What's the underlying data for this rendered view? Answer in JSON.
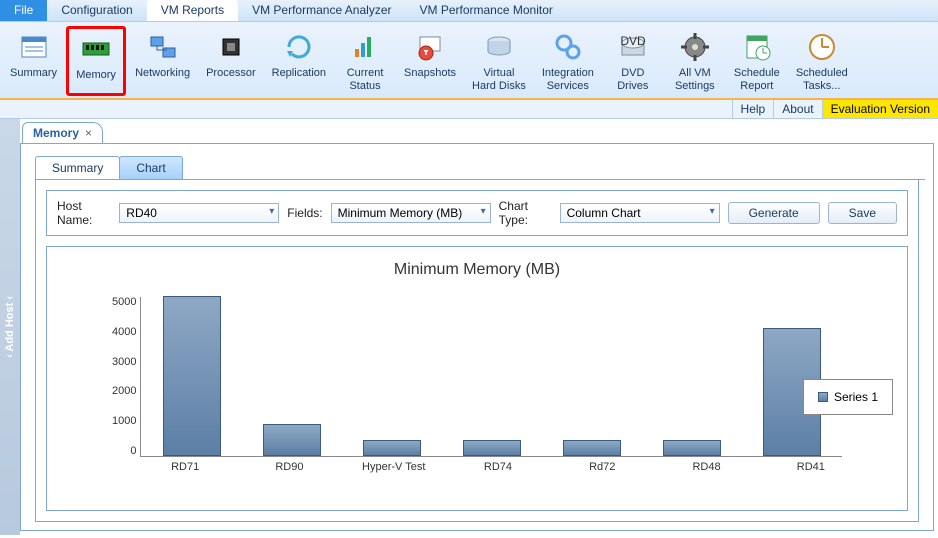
{
  "menu": {
    "file": "File",
    "config": "Configuration",
    "vmreports": "VM Reports",
    "analyzer": "VM Performance Analyzer",
    "monitor": "VM Performance Monitor"
  },
  "ribbon": {
    "summary": "Summary",
    "memory": "Memory",
    "networking": "Networking",
    "processor": "Processor",
    "replication": "Replication",
    "current_status": "Current\nStatus",
    "snapshots": "Snapshots",
    "virtual_hard_disks": "Virtual\nHard Disks",
    "integration_services": "Integration\nServices",
    "dvd_drives": "DVD\nDrives",
    "all_vm_settings": "All VM\nSettings",
    "schedule_report": "Schedule\nReport",
    "scheduled_tasks": "Scheduled\nTasks..."
  },
  "helpline": {
    "help": "Help",
    "about": "About",
    "eval": "Evaluation Version"
  },
  "side": {
    "add_host": "‹   Add Host   ‹"
  },
  "doc_tab": {
    "label": "Memory",
    "close": "×"
  },
  "inner_tabs": {
    "summary": "Summary",
    "chart": "Chart"
  },
  "controls": {
    "host_label": "Host Name:",
    "host_value": "RD40",
    "fields_label": "Fields:",
    "fields_value": "Minimum Memory (MB)",
    "charttype_label": "Chart Type:",
    "charttype_value": "Column Chart",
    "generate": "Generate",
    "save": "Save"
  },
  "chart_data": {
    "type": "bar",
    "title": "Minimum Memory (MB)",
    "categories": [
      "RD71",
      "RD90",
      "Hyper-V Test",
      "RD74",
      "Rd72",
      "RD48",
      "RD41"
    ],
    "values": [
      5000,
      1000,
      500,
      500,
      500,
      500,
      4000
    ],
    "ylabel": "",
    "xlabel": "",
    "ylim": [
      0,
      5000
    ],
    "yticks": [
      0,
      1000,
      2000,
      3000,
      4000,
      5000
    ],
    "series": [
      {
        "name": "Series 1",
        "values": [
          5000,
          1000,
          500,
          500,
          500,
          500,
          4000
        ]
      }
    ],
    "legend": "Series 1"
  }
}
